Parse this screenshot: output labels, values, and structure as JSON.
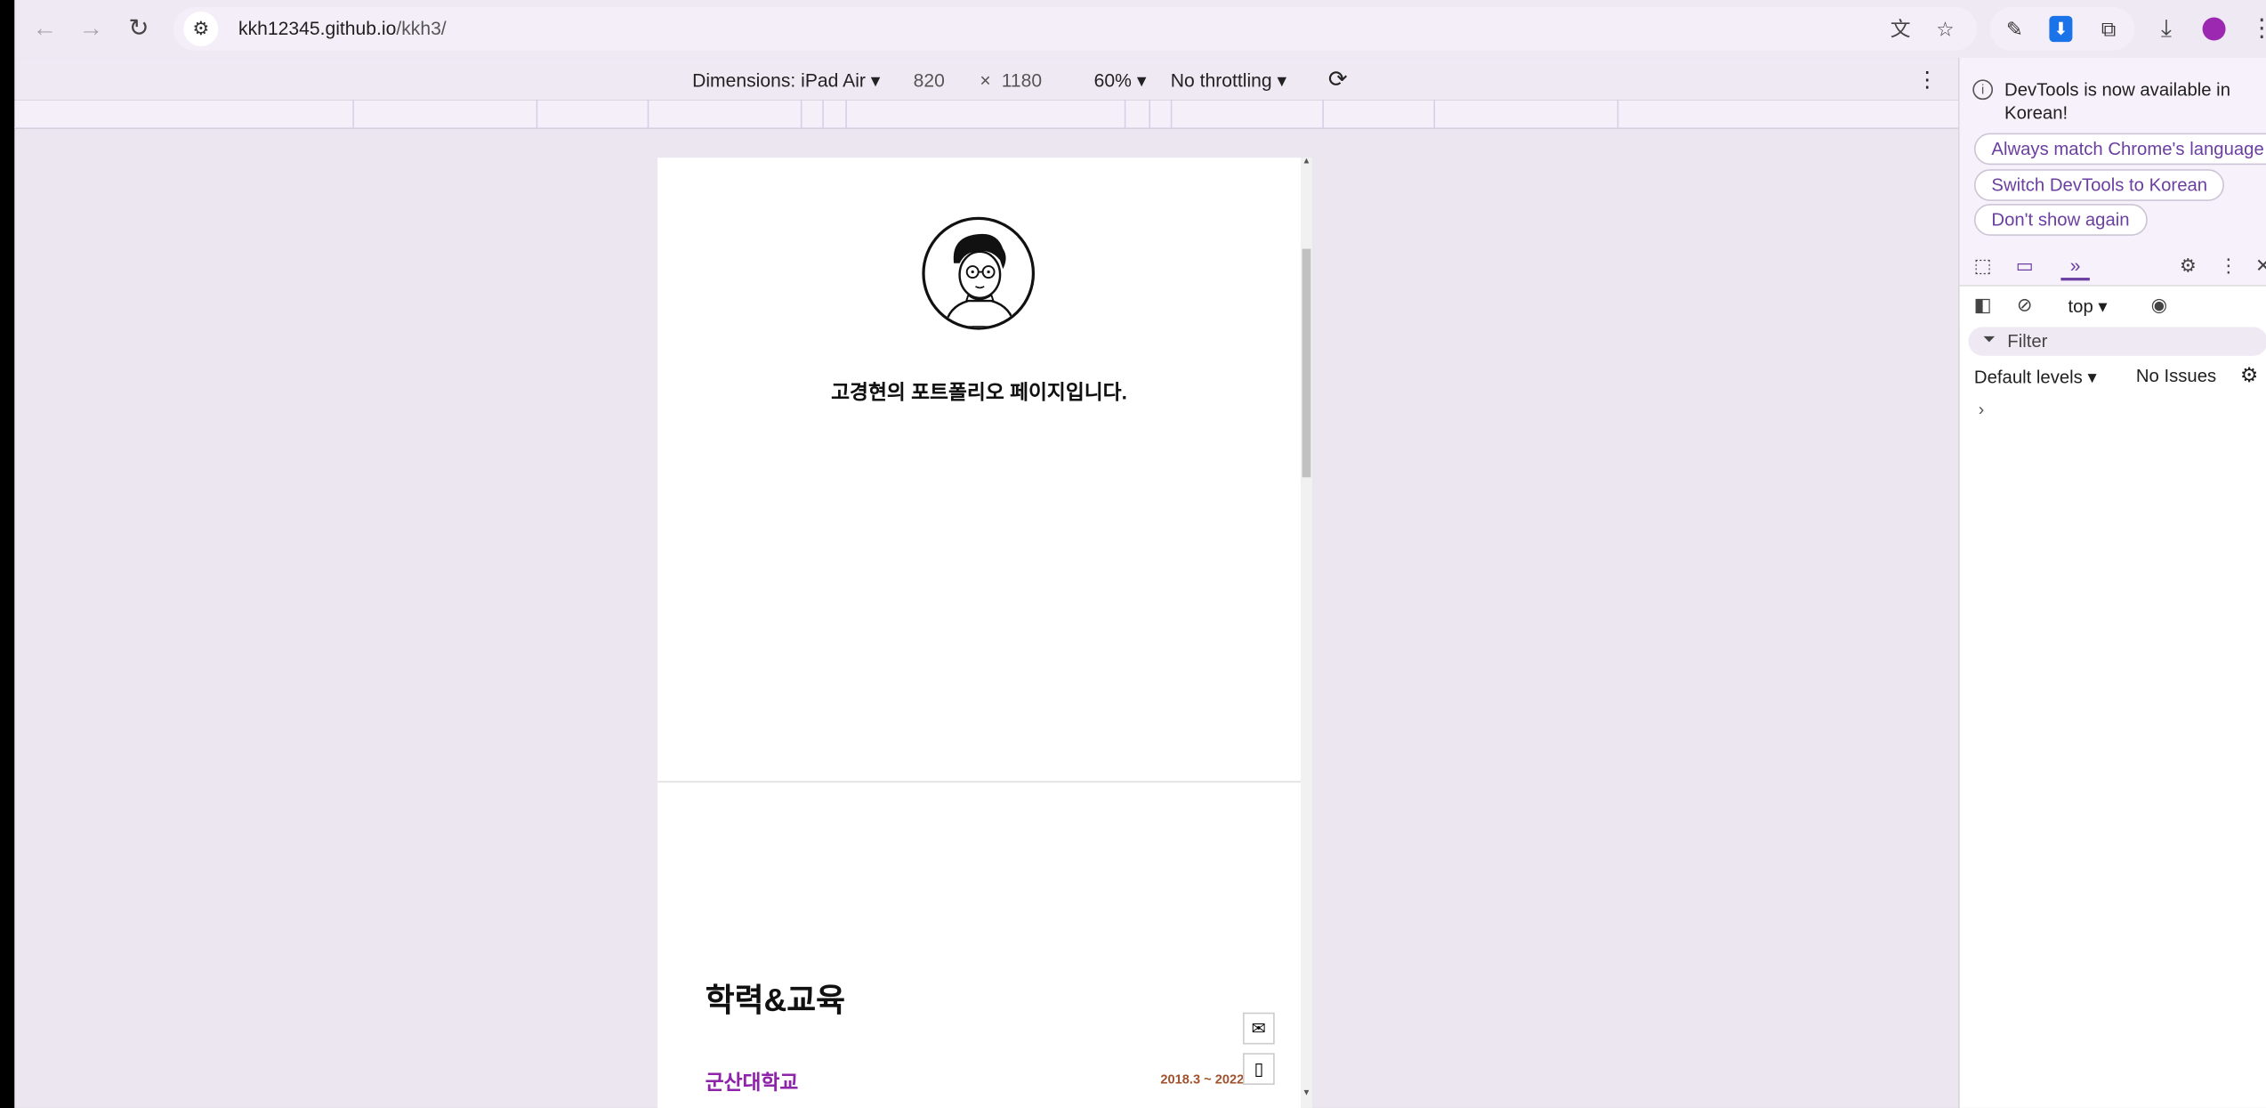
{
  "browser": {
    "url_domain": "kkh12345.github.io",
    "url_path": "/kkh3/"
  },
  "device_toolbar": {
    "dimensions_label": "Dimensions: iPad Air",
    "width": "820",
    "times": "×",
    "height": "1180",
    "zoom": "60%",
    "throttling": "No throttling"
  },
  "page": {
    "intro_text": "고경현의 포트폴리오 페이지입니다.",
    "education_title": "학력&교육",
    "school_name": "군산대학교",
    "school_period": "2018.3 ~ 2022."
  },
  "devtools": {
    "notice_text": "DevTools is now available in Korean!",
    "btn_match_language": "Always match Chrome's language",
    "btn_switch_korean": "Switch DevTools to Korean",
    "btn_dont_show": "Don't show again",
    "context_selector": "top",
    "filter_placeholder": "Filter",
    "default_levels": "Default levels",
    "issues": "No Issues",
    "prompt": "›"
  },
  "colors": {
    "accent_purple": "#8e24aa",
    "period_brown": "#a0522d",
    "chrome_bg": "#efe9f4"
  }
}
